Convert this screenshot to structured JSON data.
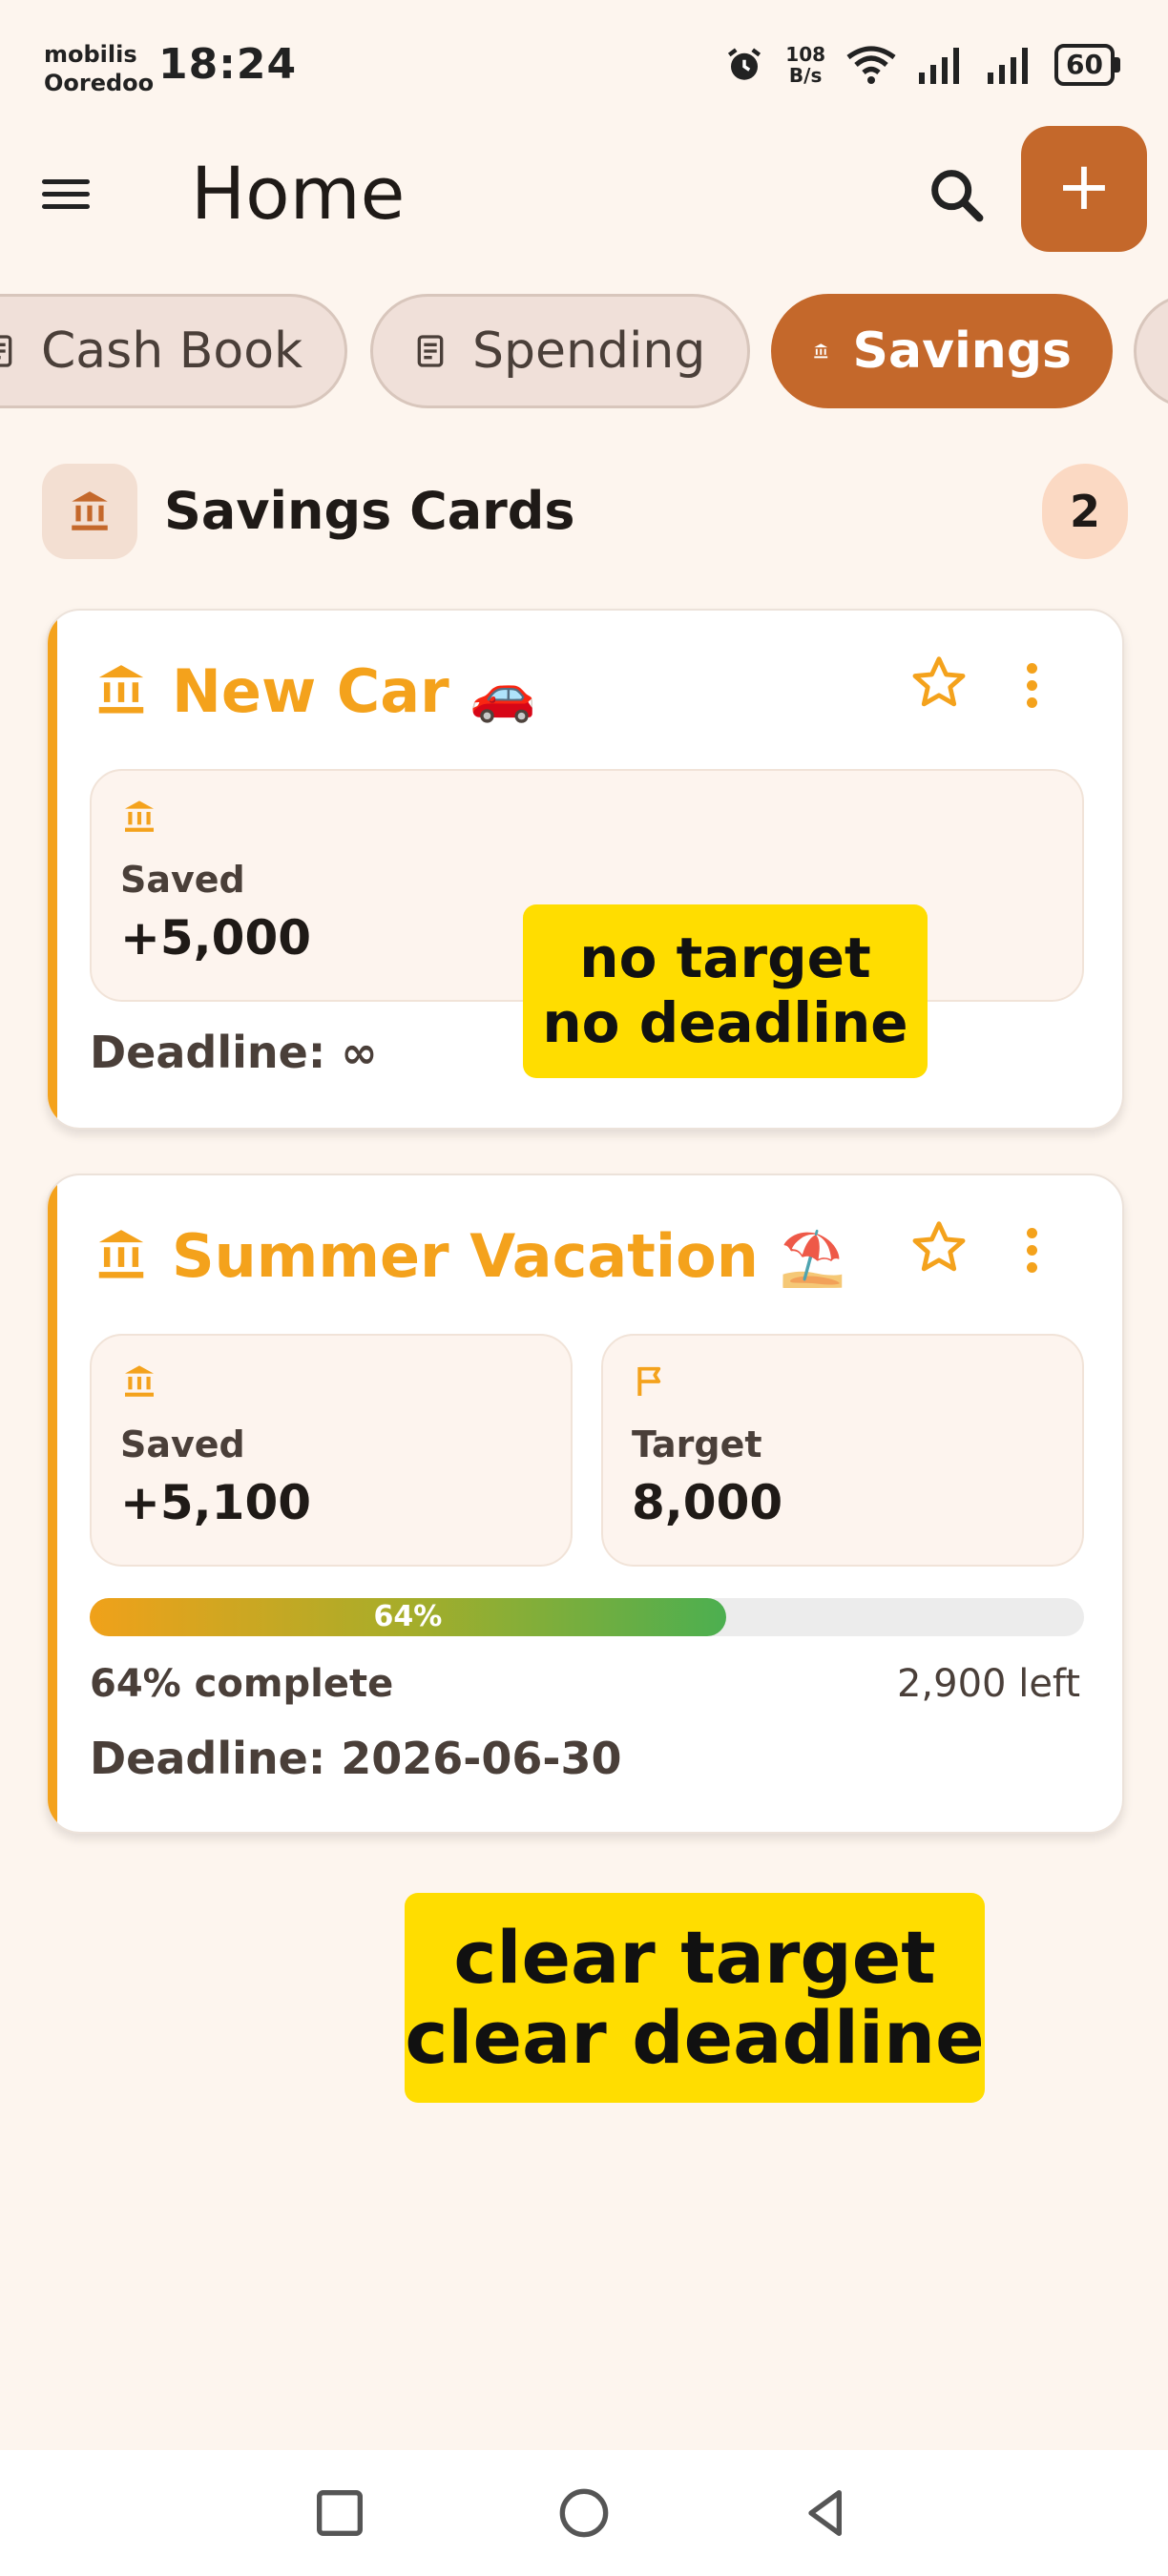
{
  "status_bar": {
    "carrier_1": "mobilis",
    "carrier_2": "Ooredoo",
    "time": "18:24",
    "net_speed_value": "108",
    "net_speed_unit": "B/s",
    "battery": "60"
  },
  "app_bar": {
    "title": "Home",
    "add_label": "+"
  },
  "tabs": [
    {
      "label": "Cash Book",
      "active": false
    },
    {
      "label": "Spending",
      "active": false
    },
    {
      "label": "Savings",
      "active": true
    }
  ],
  "section": {
    "title": "Savings Cards",
    "count": "2"
  },
  "cards": [
    {
      "title": "New Car",
      "emoji": "🚗",
      "saved_label": "Saved",
      "saved_value": "+5,000",
      "deadline": "Deadline: ∞"
    },
    {
      "title": "Summer Vacation",
      "emoji": "⛱️",
      "saved_label": "Saved",
      "saved_value": "+5,100",
      "target_label": "Target",
      "target_value": "8,000",
      "progress_fraction": 0.64,
      "progress_label": "64%",
      "complete_text": "64% complete",
      "left_text": "2,900 left",
      "deadline": "Deadline: 2026-06-30"
    }
  ],
  "annotations": {
    "note_1_line_1": "no target",
    "note_1_line_2": "no deadline",
    "note_2_line_1": "clear target",
    "note_2_line_2": "clear deadline"
  },
  "colors": {
    "accent": "#c4682b",
    "card_accent": "#f4a21c",
    "background": "#fdf5ee",
    "annotation": "#ffdd00"
  },
  "icons": {
    "menu": "menu-icon",
    "search": "search-icon",
    "bank": "bank-icon",
    "receipt": "receipt-icon",
    "star": "star-outline-icon",
    "more": "more-vert-icon",
    "flag": "flag-icon"
  }
}
